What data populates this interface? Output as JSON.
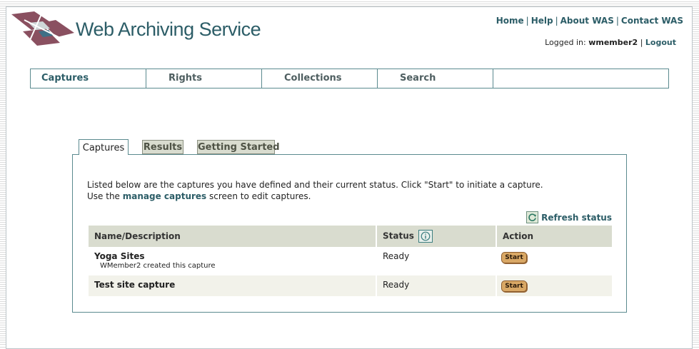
{
  "app": {
    "title": "Web Archiving Service",
    "accent_color": "#2c5d67"
  },
  "header": {
    "links": [
      "Home",
      "Help",
      "About WAS",
      "Contact WAS"
    ],
    "login_prefix": "Logged in:",
    "username": "wmember2",
    "logout_label": "Logout"
  },
  "nav": {
    "items": [
      "Captures",
      "Rights",
      "Collections",
      "Search"
    ]
  },
  "tabs": [
    {
      "label": "Captures",
      "active": true
    },
    {
      "label": "Results",
      "active": false
    },
    {
      "label": "Getting Started",
      "active": false
    }
  ],
  "panel": {
    "intro_line1": "Listed below are the captures you have defined and their current status. Click \"Start\" to initiate a capture.",
    "intro_line2_pre": "Use the",
    "intro_link": "manage captures",
    "intro_line2_post": "screen to edit captures.",
    "refresh_label": "Refresh status"
  },
  "table": {
    "columns": [
      "Name/Description",
      "Status",
      "Action"
    ],
    "rows": [
      {
        "name": "Yoga Sites",
        "description": "WMember2 created this capture",
        "status": "Ready",
        "action": "Start"
      },
      {
        "name": "Test site capture",
        "description": "",
        "status": "Ready",
        "action": "Start"
      }
    ]
  }
}
